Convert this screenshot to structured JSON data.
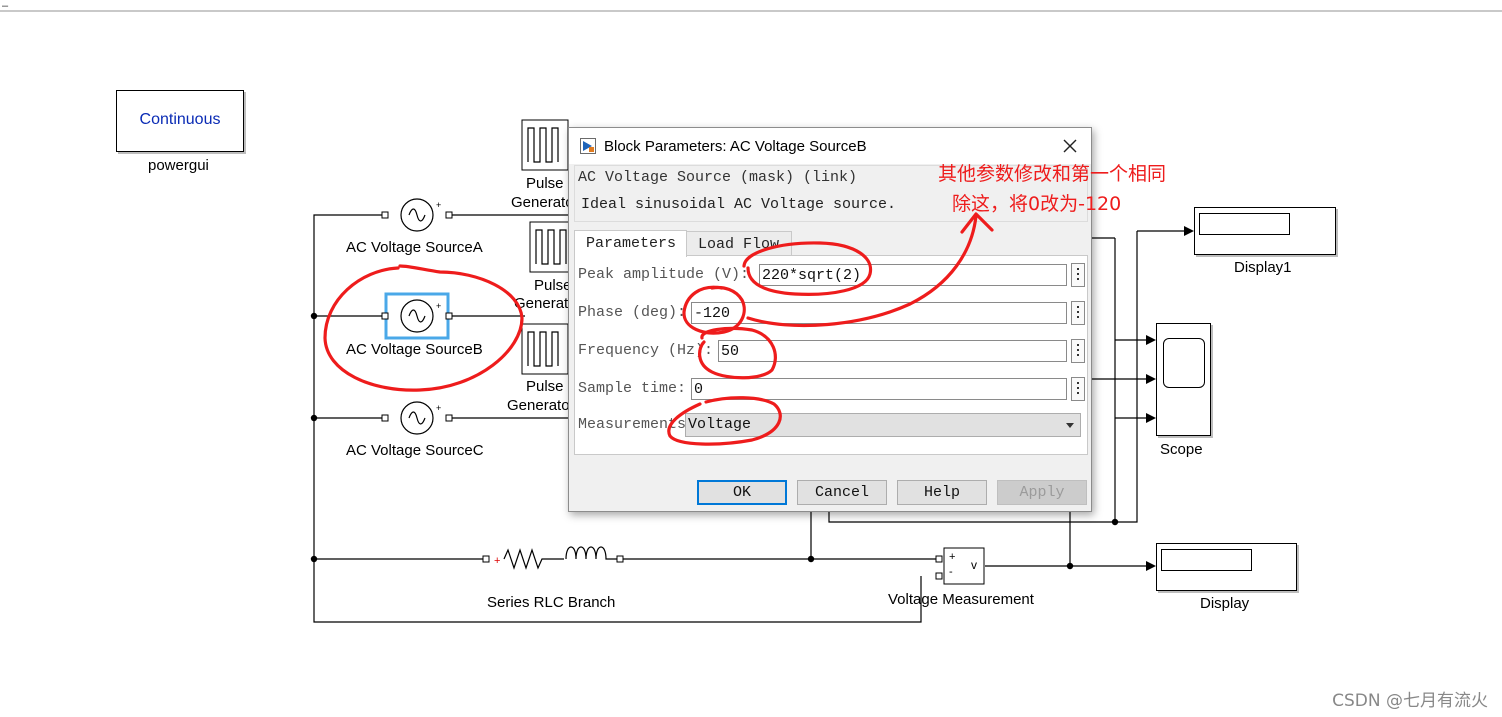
{
  "window": {
    "corner_mark": "–"
  },
  "blocks": {
    "powergui": {
      "mode": "Continuous",
      "label": "powergui"
    },
    "ac_source_a": {
      "label": "AC Voltage SourceA"
    },
    "ac_source_b": {
      "label": "AC Voltage SourceB"
    },
    "ac_source_c": {
      "label": "AC Voltage SourceC"
    },
    "pulse_1": {
      "label_line1": "Pulse",
      "label_line2": "Generato"
    },
    "pulse_2": {
      "label_line1": "Pulse",
      "label_line2": "Generato"
    },
    "pulse_3": {
      "label_line1": "Pulse",
      "label_line2": "Generato"
    },
    "display1": {
      "label": "Display1"
    },
    "scope": {
      "label": "Scope"
    },
    "display": {
      "label": "Display"
    },
    "rlc": {
      "label": "Series RLC Branch"
    },
    "vmeas": {
      "label": "Voltage Measurement",
      "port_plus": "+",
      "port_minus": "-",
      "out": "v"
    }
  },
  "dialog": {
    "title": "Block Parameters: AC Voltage SourceB",
    "mask_title": "AC Voltage Source (mask) (link)",
    "mask_description": "Ideal sinusoidal AC Voltage source.",
    "tabs": [
      {
        "label": "Parameters",
        "active": true
      },
      {
        "label": "Load Flow",
        "active": false
      }
    ],
    "params": {
      "peak_amplitude": {
        "label": "Peak amplitude (V):",
        "value": "220*sqrt(2)"
      },
      "phase": {
        "label": "Phase (deg):",
        "value": "-120"
      },
      "frequency": {
        "label": "Frequency (Hz):",
        "value": "50"
      },
      "sample_time": {
        "label": "Sample time:",
        "value": "0"
      },
      "measurements": {
        "label": "Measurements",
        "value": "Voltage"
      }
    },
    "buttons": {
      "ok": "OK",
      "cancel": "Cancel",
      "help": "Help",
      "apply": "Apply"
    }
  },
  "annotation": {
    "line1": "其他参数修改和第一个相同",
    "line2": "除这，将0改为-120",
    "color": "#ee1c1c"
  },
  "watermark": "CSDN @七月有流火",
  "colors": {
    "selection": "#4aa8e8",
    "powergui_text": "#0a2bb5"
  }
}
